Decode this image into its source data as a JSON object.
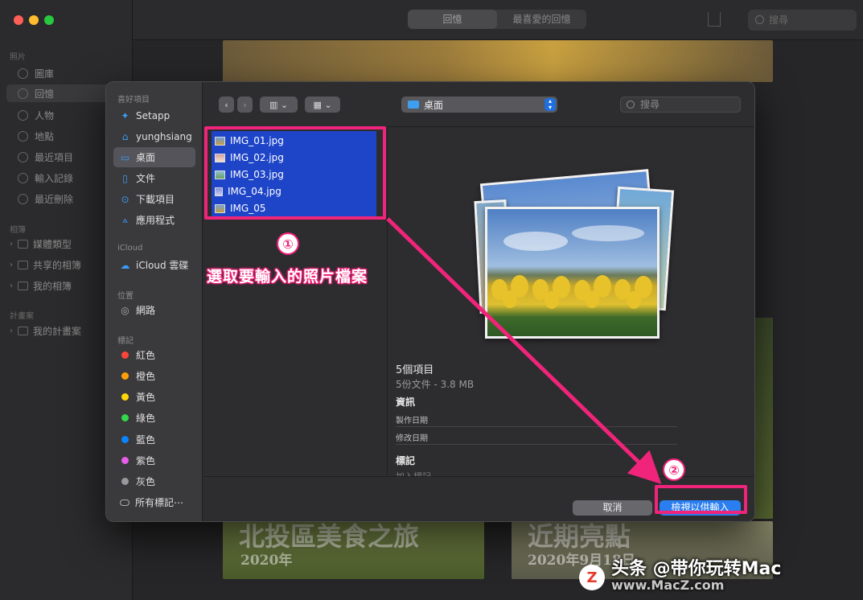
{
  "app": {
    "sidebar_sections": [
      {
        "label": "照片"
      },
      {
        "label": "相簿"
      },
      {
        "label": "計畫案"
      }
    ],
    "sidebar_items": [
      {
        "label": "圖庫"
      },
      {
        "label": "回憶"
      },
      {
        "label": "人物"
      },
      {
        "label": "地點"
      },
      {
        "label": "最近項目"
      },
      {
        "label": "輸入記錄"
      },
      {
        "label": "最近刪除"
      }
    ],
    "album_items": [
      {
        "label": "媒體類型"
      },
      {
        "label": "共享的相簿"
      },
      {
        "label": "我的相簿"
      }
    ],
    "project_items": [
      {
        "label": "我的計畫案"
      }
    ],
    "tabs": [
      {
        "label": "回憶"
      },
      {
        "label": "最喜愛的回憶"
      }
    ],
    "search_placeholder": "搜尋",
    "tiles": [
      {
        "title": "北投區美食之旅",
        "date": "2020年"
      },
      {
        "title": "近期亮點",
        "date": "2020年9月18日"
      }
    ]
  },
  "dialog": {
    "sidebar": {
      "favorites_header": "喜好項目",
      "favorites": [
        {
          "label": "Setapp",
          "icon": "setapp-icon"
        },
        {
          "label": "yunghsiang",
          "icon": "home-icon"
        },
        {
          "label": "桌面",
          "icon": "desktop-icon"
        },
        {
          "label": "文件",
          "icon": "document-icon"
        },
        {
          "label": "下載項目",
          "icon": "download-icon"
        },
        {
          "label": "應用程式",
          "icon": "applications-icon"
        }
      ],
      "icloud_header": "iCloud",
      "icloud": [
        {
          "label": "iCloud 雲碟",
          "icon": "cloud-icon"
        }
      ],
      "locations_header": "位置",
      "locations": [
        {
          "label": "網路",
          "icon": "globe-icon"
        }
      ],
      "tags_header": "標記",
      "tags": [
        {
          "label": "紅色",
          "color": "#ff453a"
        },
        {
          "label": "橙色",
          "color": "#ff9f0a"
        },
        {
          "label": "黃色",
          "color": "#ffd60a"
        },
        {
          "label": "綠色",
          "color": "#32d74b"
        },
        {
          "label": "藍色",
          "color": "#0a84ff"
        },
        {
          "label": "紫色",
          "color": "#e75ce8"
        },
        {
          "label": "灰色",
          "color": "#98989d"
        }
      ],
      "all_tags": "所有標記⋯"
    },
    "toolbar": {
      "location": "桌面",
      "search_placeholder": "搜尋"
    },
    "files": [
      {
        "name": "IMG_01.jpg"
      },
      {
        "name": "IMG_02.jpg"
      },
      {
        "name": "IMG_03.jpg"
      },
      {
        "name": "IMG_04.jpg"
      },
      {
        "name": "IMG_05"
      }
    ],
    "info": {
      "count": "5個項目",
      "summary": "5份文件 - 3.8 MB",
      "info_header": "資訊",
      "created": "製作日期",
      "modified": "修改日期",
      "tags_header": "標記",
      "add_tags": "加入標記⋯"
    },
    "buttons": {
      "cancel": "取消",
      "import": "檢視以供輸入"
    }
  },
  "annotations": {
    "step1_num": "①",
    "step1_text": "選取要輸入的照片檔案",
    "step2_num": "②",
    "accent": "#f0247a"
  },
  "watermark": {
    "text": "头条 @带你玩转Mac",
    "site": "www.MacZ.com"
  }
}
